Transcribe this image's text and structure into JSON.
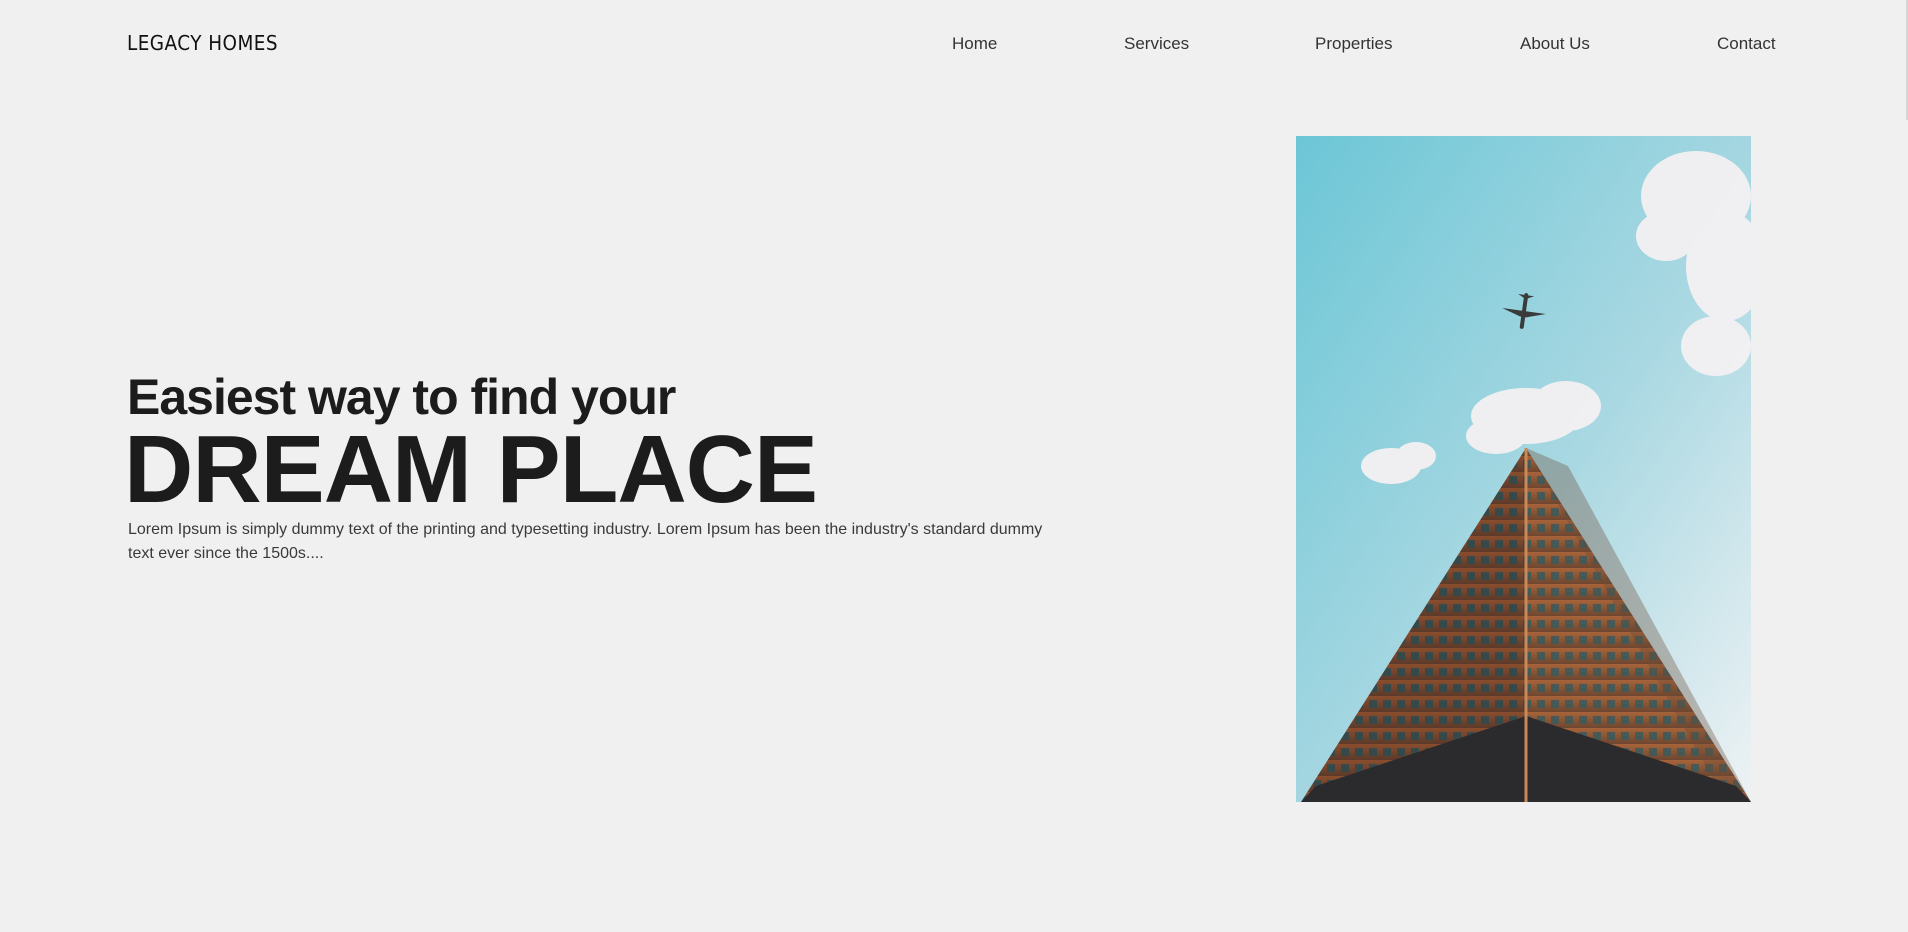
{
  "brand": {
    "name": "LEGACY HOMES"
  },
  "nav": {
    "items": [
      {
        "label": "Home"
      },
      {
        "label": "Services"
      },
      {
        "label": "Properties"
      },
      {
        "label": "About Us"
      },
      {
        "label": "Contact"
      }
    ]
  },
  "hero": {
    "pretitle": "Easiest way to find your",
    "title": "DREAM PLACE",
    "description": "Lorem Ipsum is simply dummy text of the printing and typesetting industry. Lorem Ipsum has been the industry's standard dummy text ever since the 1500s....",
    "image": {
      "subject": "skyscraper-with-airplane-photo"
    }
  },
  "colors": {
    "background": "#f0f0f0",
    "text": "#1c1c1c",
    "sky": "#7fc7d6",
    "building": "#9a5a35"
  }
}
